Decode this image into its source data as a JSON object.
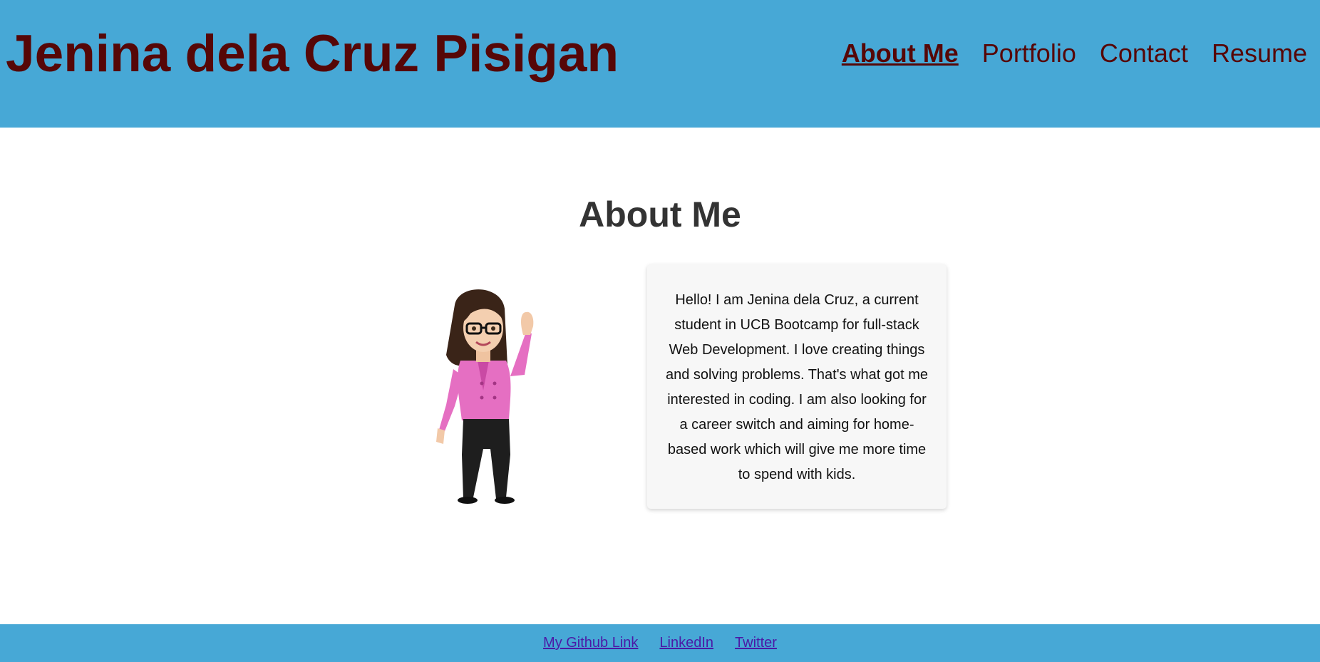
{
  "header": {
    "title": "Jenina dela Cruz Pisigan",
    "nav": [
      {
        "label": "About Me",
        "active": true
      },
      {
        "label": "Portfolio",
        "active": false
      },
      {
        "label": "Contact",
        "active": false
      },
      {
        "label": "Resume",
        "active": false
      }
    ]
  },
  "main": {
    "section_title": "About Me",
    "avatar_icon": "waving-cartoon-avatar",
    "bio": "Hello! I am Jenina dela Cruz, a current student in UCB Bootcamp for full-stack Web Development. I love creating things and solving problems. That's what got me interested in coding. I am also looking for a career switch and aiming for home-based work which will give me more time to spend with kids."
  },
  "footer": {
    "links": [
      {
        "label": "My Github Link"
      },
      {
        "label": "LinkedIn"
      },
      {
        "label": "Twitter"
      }
    ]
  },
  "colors": {
    "bar_bg": "#47a8d6",
    "title": "#560707",
    "heading": "#333333",
    "footer_link": "#4b1aa6"
  }
}
